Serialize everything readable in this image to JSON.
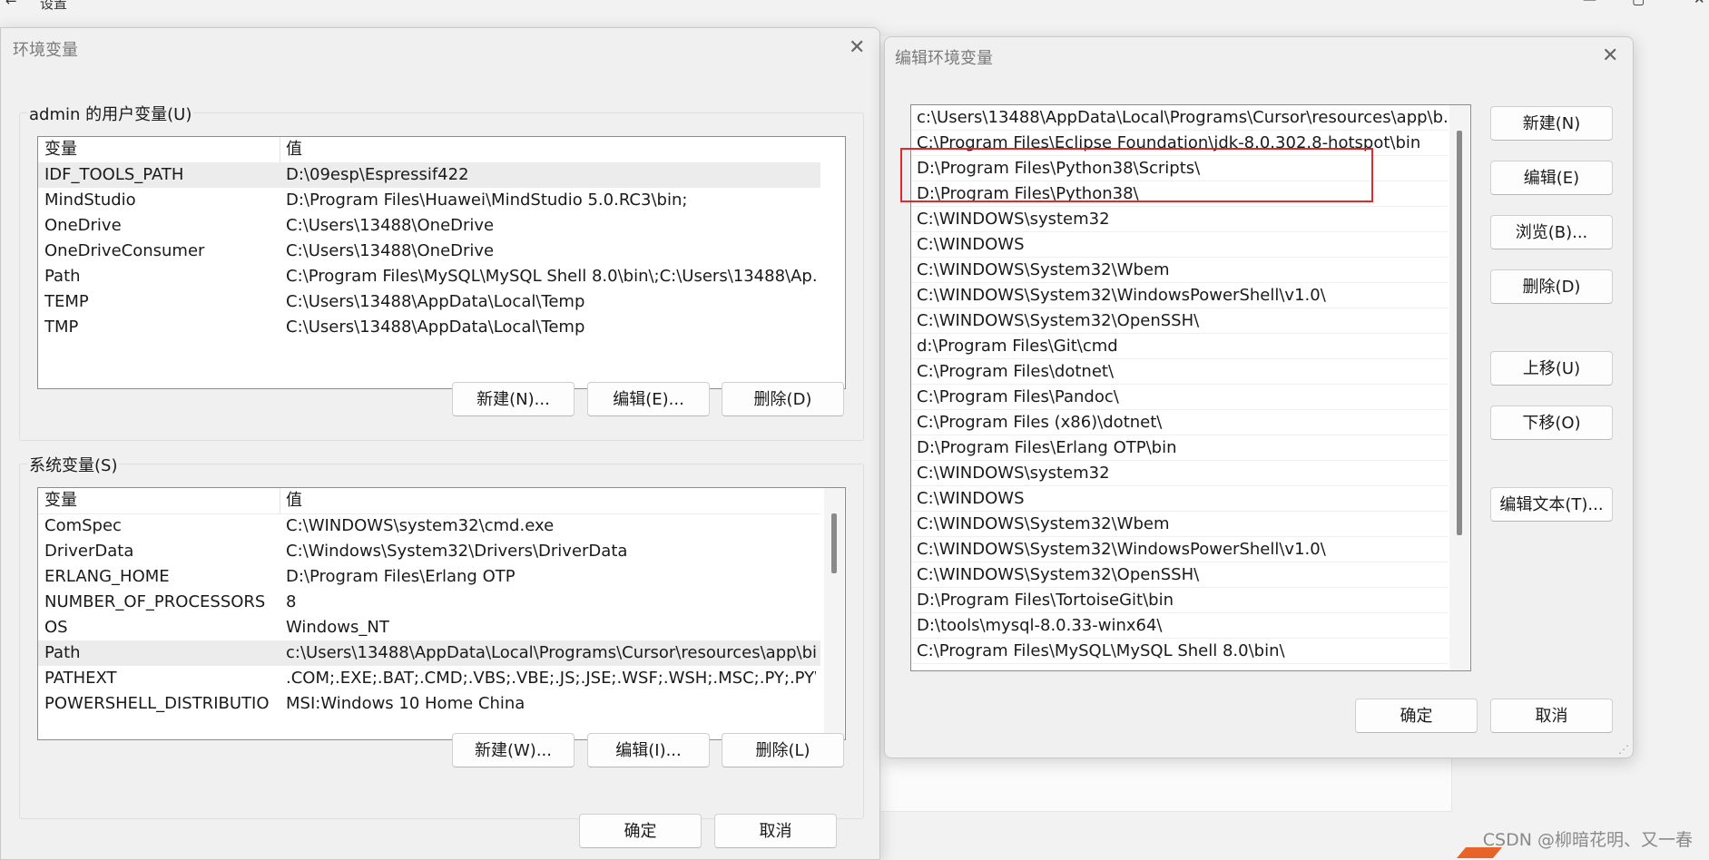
{
  "background_app": {
    "title": "设置",
    "back_glyph": "←",
    "min_glyph": "—",
    "restore_glyph": "▢",
    "close_glyph": "✕"
  },
  "env_dialog": {
    "title": "环境变量",
    "close_glyph": "✕",
    "user_group": {
      "label": "admin 的用户变量(U)",
      "columns": [
        "变量",
        "值"
      ],
      "rows": [
        [
          "IDF_TOOLS_PATH",
          "D:\\09esp\\Espressif422"
        ],
        [
          "MindStudio",
          "D:\\Program Files\\Huawei\\MindStudio 5.0.RC3\\bin;"
        ],
        [
          "OneDrive",
          "C:\\Users\\13488\\OneDrive"
        ],
        [
          "OneDriveConsumer",
          "C:\\Users\\13488\\OneDrive"
        ],
        [
          "Path",
          "C:\\Program Files\\MySQL\\MySQL Shell 8.0\\bin\\;C:\\Users\\13488\\Ap..."
        ],
        [
          "TEMP",
          "C:\\Users\\13488\\AppData\\Local\\Temp"
        ],
        [
          "TMP",
          "C:\\Users\\13488\\AppData\\Local\\Temp"
        ]
      ],
      "selected_index": 0,
      "buttons": {
        "new": "新建(N)...",
        "edit": "编辑(E)...",
        "delete": "删除(D)"
      }
    },
    "system_group": {
      "label": "系统变量(S)",
      "columns": [
        "变量",
        "值"
      ],
      "rows": [
        [
          "ComSpec",
          "C:\\WINDOWS\\system32\\cmd.exe"
        ],
        [
          "DriverData",
          "C:\\Windows\\System32\\Drivers\\DriverData"
        ],
        [
          "ERLANG_HOME",
          "D:\\Program Files\\Erlang OTP"
        ],
        [
          "NUMBER_OF_PROCESSORS",
          "8"
        ],
        [
          "OS",
          "Windows_NT"
        ],
        [
          "Path",
          "c:\\Users\\13488\\AppData\\Local\\Programs\\Cursor\\resources\\app\\bi..."
        ],
        [
          "PATHEXT",
          ".COM;.EXE;.BAT;.CMD;.VBS;.VBE;.JS;.JSE;.WSF;.WSH;.MSC;.PY;.PYW"
        ],
        [
          "POWERSHELL_DISTRIBUTIO",
          "MSI:Windows 10 Home China"
        ]
      ],
      "selected_index": 5,
      "buttons": {
        "new": "新建(W)...",
        "edit": "编辑(I)...",
        "delete": "删除(L)"
      }
    },
    "ok": "确定",
    "cancel": "取消"
  },
  "edit_dialog": {
    "title": "编辑环境变量",
    "close_glyph": "✕",
    "entries": [
      "c:\\Users\\13488\\AppData\\Local\\Programs\\Cursor\\resources\\app\\b...",
      "C:\\Program Files\\Eclipse Foundation\\jdk-8.0.302.8-hotspot\\bin",
      "D:\\Program Files\\Python38\\Scripts\\",
      "D:\\Program Files\\Python38\\",
      "C:\\WINDOWS\\system32",
      "C:\\WINDOWS",
      "C:\\WINDOWS\\System32\\Wbem",
      "C:\\WINDOWS\\System32\\WindowsPowerShell\\v1.0\\",
      "C:\\WINDOWS\\System32\\OpenSSH\\",
      "d:\\Program Files\\Git\\cmd",
      "C:\\Program Files\\dotnet\\",
      "C:\\Program Files\\Pandoc\\",
      "C:\\Program Files (x86)\\dotnet\\",
      "D:\\Program Files\\Erlang OTP\\bin",
      "C:\\WINDOWS\\system32",
      "C:\\WINDOWS",
      "C:\\WINDOWS\\System32\\Wbem",
      "C:\\WINDOWS\\System32\\WindowsPowerShell\\v1.0\\",
      "C:\\WINDOWS\\System32\\OpenSSH\\",
      "D:\\Program Files\\TortoiseGit\\bin",
      "D:\\tools\\mysql-8.0.33-winx64\\",
      "C:\\Program Files\\MySQL\\MySQL Shell 8.0\\bin\\"
    ],
    "buttons": {
      "new": "新建(N)",
      "edit": "编辑(E)",
      "browse": "浏览(B)...",
      "delete": "删除(D)",
      "move_up": "上移(U)",
      "move_down": "下移(O)",
      "edit_text": "编辑文本(T)..."
    },
    "ok": "确定",
    "cancel": "取消",
    "highlight_color": "#e0282e"
  },
  "watermark": "CSDN @柳暗花明、又一春"
}
